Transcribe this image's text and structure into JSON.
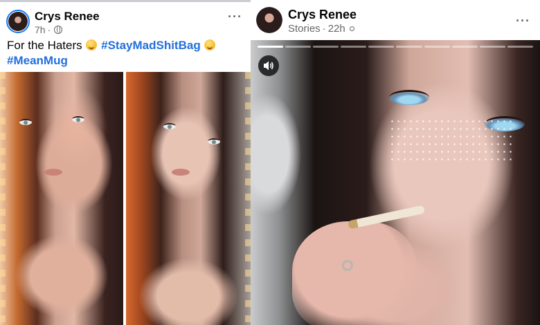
{
  "post": {
    "author": "Crys Renee",
    "time": "7h",
    "privacy_icon": "globe-icon",
    "more_icon": "more-options-icon",
    "more_label": "···",
    "caption": {
      "text": "For the Haters",
      "emoji_1": "winking-kiss-emoji",
      "hashtag_1": "#StayMadShitBag",
      "emoji_2": "zany-face-emoji",
      "hashtag_2": "#MeanMug"
    },
    "photos": [
      "selfie-photo-1",
      "selfie-photo-2"
    ]
  },
  "story": {
    "author": "Crys Renee",
    "source": "Stories",
    "time": "22h",
    "separator": "·",
    "privacy_icon": "friends-icon",
    "more_label": "···",
    "progress_segments": 10,
    "progress_completed": 1,
    "sound_icon": "speaker-icon"
  },
  "colors": {
    "hashtag": "#216fdb",
    "name": "#050505",
    "meta": "#65676b",
    "story_ring": "#1877f2"
  }
}
